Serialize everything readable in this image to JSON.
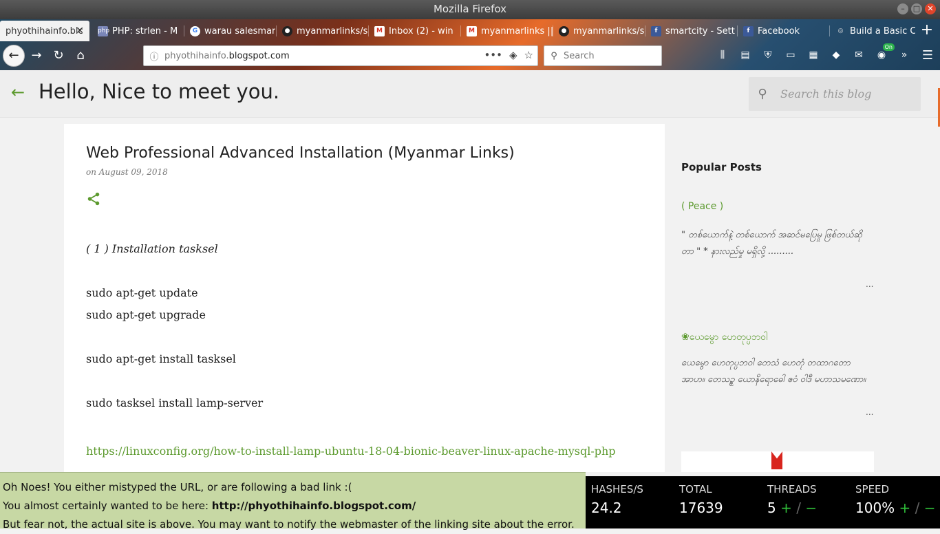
{
  "window": {
    "title": "Mozilla Firefox"
  },
  "tabs": [
    {
      "label": "phyothihainfo.blc",
      "favicon": "blogger-icon",
      "active": true
    },
    {
      "label": "PHP: strlen - M",
      "favicon": "php-icon"
    },
    {
      "label": "warau salesmar",
      "favicon": "google-icon"
    },
    {
      "label": "myanmarlinks/s",
      "favicon": "github-icon"
    },
    {
      "label": "Inbox (2) - win",
      "favicon": "gmail-icon"
    },
    {
      "label": "myanmarlinks ||",
      "favicon": "gmail-icon"
    },
    {
      "label": "myanmarlinks/s",
      "favicon": "github-icon"
    },
    {
      "label": "smartcity - Sett",
      "favicon": "facebook-icon"
    },
    {
      "label": "Facebook",
      "favicon": "facebook-icon"
    },
    {
      "label": "Build a Basic CF",
      "favicon": "camera-icon"
    }
  ],
  "url": {
    "prefix": "phyothihainfo.",
    "host": "blogspot.com"
  },
  "browser_search": {
    "placeholder": "Search"
  },
  "toolbar_badge": "On",
  "blog": {
    "title": "Hello, Nice to meet you.",
    "search_placeholder": "Search this blog"
  },
  "post": {
    "title": "Web Professional Advanced Installation (Myanmar Links)",
    "date": "on August 09, 2018",
    "lines": [
      "( 1 ) Installation tasksel",
      "sudo apt-get update",
      "sudo apt-get upgrade",
      "sudo apt-get install tasksel",
      "sudo tasksel install lamp-server"
    ],
    "link": "https://linuxconfig.org/how-to-install-lamp-ubuntu-18-04-bionic-beaver-linux-apache-mysql-php"
  },
  "sidebar": {
    "heading": "Popular Posts",
    "posts": [
      {
        "title": "( Peace )",
        "snippet": "\" တစ်ယောက်နဲ့ တစ်ယောက် အဆင်မပြေမှု ဖြစ်တယ်ဆိုတာ \" * နားလည်မှု မရှိလို့ .........",
        "more": "..."
      },
      {
        "title": "❀ယေမွော ဟေတုပ္ပဘဝါ",
        "snippet": "ယေမွော ဟေတုပ္ပဘဝါ တေသံ ဟေတုံ တထာဂတော အာဟ။ တေသဉ္စ ယောနိရောဓေါ ဧဝံ ဝါဒီ မဟာသမဏော။",
        "more": "..."
      }
    ]
  },
  "notice": {
    "line1": "Oh Noes! You either mistyped the URL, or are following a bad link :(",
    "line2_prefix": "You almost certainly wanted to be here: ",
    "line2_url": "http://phyothihainfo.blogspot.com/",
    "line3": "But fear not, the actual site is above. You may want to notify the webmaster of the linking site about the error."
  },
  "miner": {
    "hashes_label": "HASHES/S",
    "hashes_value": "24.2",
    "total_label": "TOTAL",
    "total_value": "17639",
    "threads_label": "THREADS",
    "threads_value": "5",
    "speed_label": "SPEED",
    "speed_value": "100%",
    "plus": "+",
    "slash": "/",
    "minus": "−"
  }
}
